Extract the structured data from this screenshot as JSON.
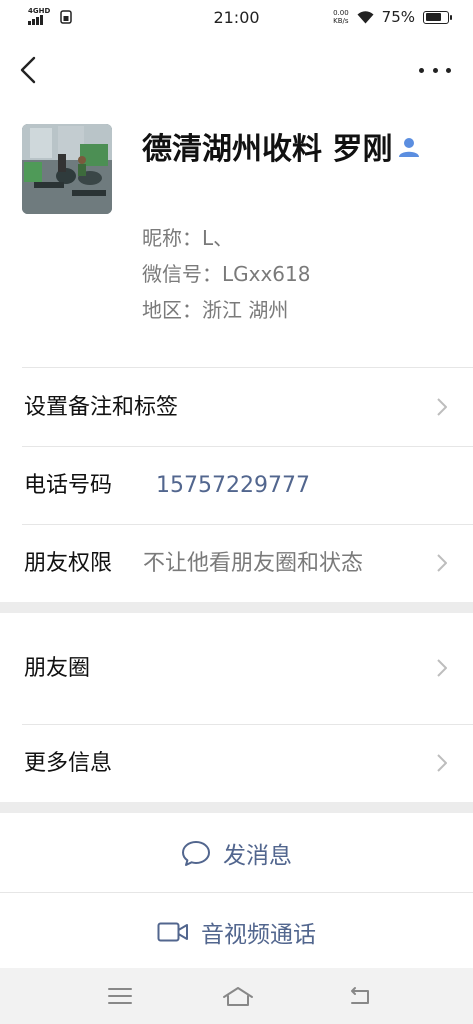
{
  "status_bar": {
    "network": "4GHD",
    "time": "21:00",
    "speed_value": "0.00",
    "speed_unit": "KB/s",
    "battery": "75%",
    "battery_level": 0.75
  },
  "profile": {
    "name": "德清湖州收料 罗刚",
    "nickname": "昵称：L、",
    "wechat_id": "微信号：LGxx618",
    "region": "地区：浙江  湖州"
  },
  "rows": {
    "remark_label": "设置备注和标签",
    "phone_label": "电话号码",
    "phone_value": "15757229777",
    "permission_label": "朋友权限",
    "permission_value": "不让他看朋友圈和状态",
    "moments_label": "朋友圈",
    "more_label": "更多信息"
  },
  "actions": {
    "message_label": "发消息",
    "call_label": "音视频通话"
  },
  "colors": {
    "link": "#52668e",
    "contact_icon": "#5b8ee0"
  }
}
